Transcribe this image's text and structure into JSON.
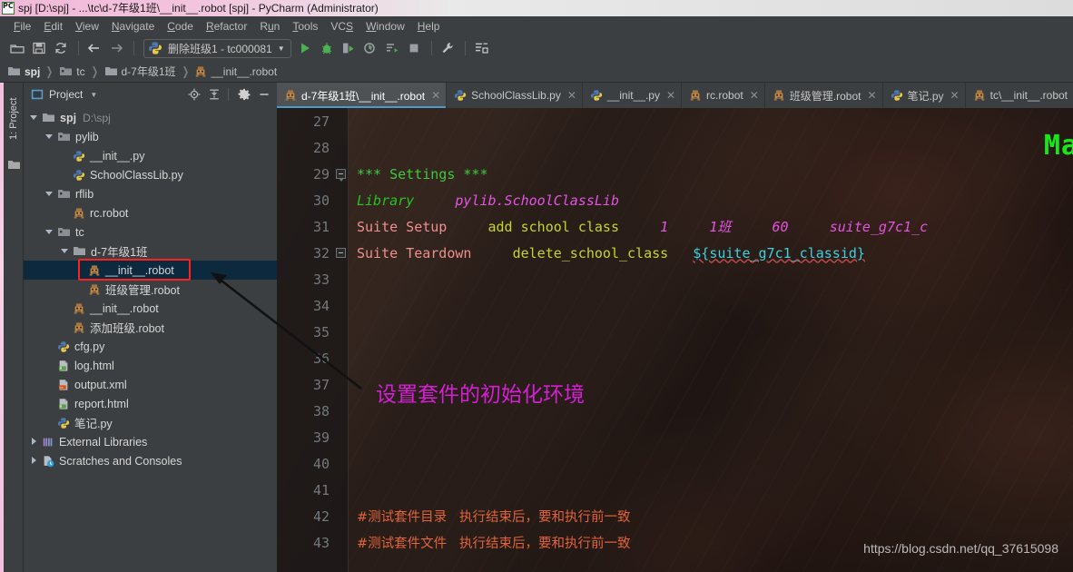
{
  "window": {
    "title": "spj [D:\\spj] - ...\\tc\\d-7年级1班\\__init__.robot [spj] - PyCharm (Administrator)",
    "app_icon": "pycharm-icon"
  },
  "menubar": {
    "items": [
      {
        "label": "File",
        "mnemonic": "F"
      },
      {
        "label": "Edit",
        "mnemonic": "E"
      },
      {
        "label": "View",
        "mnemonic": "V"
      },
      {
        "label": "Navigate",
        "mnemonic": "N"
      },
      {
        "label": "Code",
        "mnemonic": "C"
      },
      {
        "label": "Refactor",
        "mnemonic": "R"
      },
      {
        "label": "Run",
        "mnemonic": "u"
      },
      {
        "label": "Tools",
        "mnemonic": "T"
      },
      {
        "label": "VCS",
        "mnemonic": "S"
      },
      {
        "label": "Window",
        "mnemonic": "W"
      },
      {
        "label": "Help",
        "mnemonic": "H"
      }
    ]
  },
  "toolbar": {
    "buttons": [
      {
        "name": "open-icon"
      },
      {
        "name": "save-all-icon"
      },
      {
        "name": "sync-refresh-icon"
      },
      {
        "name": "back-arrow-icon"
      },
      {
        "name": "forward-arrow-icon"
      }
    ],
    "run_config": {
      "label": "删除班级1 - tc000081",
      "icon": "python-icon",
      "arrow": "▼"
    },
    "run_buttons": [
      {
        "name": "run-icon"
      },
      {
        "name": "debug-icon"
      },
      {
        "name": "run-with-coverage-icon"
      },
      {
        "name": "profile-icon"
      },
      {
        "name": "run-dashboard-icon"
      },
      {
        "name": "stop-icon"
      }
    ],
    "trailing": [
      {
        "name": "settings-wrench-icon"
      },
      {
        "name": "project-structure-icon"
      }
    ]
  },
  "breadcrumb": {
    "items": [
      {
        "label": "spj",
        "icon": "folder-icon",
        "bold": true
      },
      {
        "label": "tc",
        "icon": "module-icon",
        "bold": false
      },
      {
        "label": "d-7年级1班",
        "icon": "folder-icon",
        "bold": false
      },
      {
        "label": "__init__.robot",
        "icon": "robot-icon",
        "bold": false
      }
    ],
    "separator": "❯"
  },
  "toolstrip": {
    "label": "1: Project",
    "folder_icon": "folder-icon"
  },
  "project_panel": {
    "title": "Project",
    "dropdown_arrow": "▼",
    "header_buttons": [
      {
        "name": "locate-target-icon"
      },
      {
        "name": "collapse-all-icon"
      },
      {
        "name": "gear-icon"
      },
      {
        "name": "hide-minimize-icon"
      }
    ],
    "tree": [
      {
        "label": "spj",
        "sub": "D:\\spj",
        "icon": "folder-icon",
        "indent": 0,
        "twisty": "down",
        "bold": true,
        "selected": false
      },
      {
        "label": "pylib",
        "sub": "",
        "icon": "module-icon",
        "indent": 1,
        "twisty": "down",
        "bold": false,
        "selected": false
      },
      {
        "label": "__init__.py",
        "sub": "",
        "icon": "python-icon",
        "indent": 2,
        "twisty": "none",
        "bold": false,
        "selected": false
      },
      {
        "label": "SchoolClassLib.py",
        "sub": "",
        "icon": "python-icon",
        "indent": 2,
        "twisty": "none",
        "bold": false,
        "selected": false
      },
      {
        "label": "rflib",
        "sub": "",
        "icon": "module-icon",
        "indent": 1,
        "twisty": "down",
        "bold": false,
        "selected": false
      },
      {
        "label": "rc.robot",
        "sub": "",
        "icon": "robot-icon",
        "indent": 2,
        "twisty": "none",
        "bold": false,
        "selected": false
      },
      {
        "label": "tc",
        "sub": "",
        "icon": "module-icon",
        "indent": 1,
        "twisty": "down",
        "bold": false,
        "selected": false
      },
      {
        "label": "d-7年级1班",
        "sub": "",
        "icon": "folder-icon",
        "indent": 2,
        "twisty": "down",
        "bold": false,
        "selected": false
      },
      {
        "label": "__init__.robot",
        "sub": "",
        "icon": "robot-icon",
        "indent": 3,
        "twisty": "none",
        "bold": false,
        "selected": true
      },
      {
        "label": "班级管理.robot",
        "sub": "",
        "icon": "robot-icon",
        "indent": 3,
        "twisty": "none",
        "bold": false,
        "selected": false
      },
      {
        "label": "__init__.robot",
        "sub": "",
        "icon": "robot-icon",
        "indent": 2,
        "twisty": "none",
        "bold": false,
        "selected": false
      },
      {
        "label": "添加班级.robot",
        "sub": "",
        "icon": "robot-icon",
        "indent": 2,
        "twisty": "none",
        "bold": false,
        "selected": false
      },
      {
        "label": "cfg.py",
        "sub": "",
        "icon": "python-icon",
        "indent": 1,
        "twisty": "none",
        "bold": false,
        "selected": false
      },
      {
        "label": "log.html",
        "sub": "",
        "icon": "html-icon",
        "indent": 1,
        "twisty": "none",
        "bold": false,
        "selected": false
      },
      {
        "label": "output.xml",
        "sub": "",
        "icon": "xml-icon",
        "indent": 1,
        "twisty": "none",
        "bold": false,
        "selected": false
      },
      {
        "label": "report.html",
        "sub": "",
        "icon": "html-icon",
        "indent": 1,
        "twisty": "none",
        "bold": false,
        "selected": false
      },
      {
        "label": "笔记.py",
        "sub": "",
        "icon": "python-icon",
        "indent": 1,
        "twisty": "none",
        "bold": false,
        "selected": false
      },
      {
        "label": "External Libraries",
        "sub": "",
        "icon": "libraries-icon",
        "indent": 0,
        "twisty": "right",
        "bold": false,
        "selected": false
      },
      {
        "label": "Scratches and Consoles",
        "sub": "",
        "icon": "scratches-icon",
        "indent": 0,
        "twisty": "right",
        "bold": false,
        "selected": false
      }
    ]
  },
  "editor": {
    "tabs": [
      {
        "label": "d-7年级1班\\__init__.robot",
        "icon": "robot-icon",
        "active": true,
        "close": "✕"
      },
      {
        "label": "SchoolClassLib.py",
        "icon": "python-icon",
        "active": false,
        "close": "✕"
      },
      {
        "label": "__init__.py",
        "icon": "python-icon",
        "active": false,
        "close": "✕"
      },
      {
        "label": "rc.robot",
        "icon": "robot-icon",
        "active": false,
        "close": "✕"
      },
      {
        "label": "班级管理.robot",
        "icon": "robot-icon",
        "active": false,
        "close": "✕"
      },
      {
        "label": "笔记.py",
        "icon": "python-icon",
        "active": false,
        "close": "✕"
      },
      {
        "label": "tc\\__init__.robot",
        "icon": "robot-icon",
        "active": false,
        "close": "✕"
      }
    ],
    "lines": [
      {
        "num": "27",
        "fold": "none",
        "segments": []
      },
      {
        "num": "28",
        "fold": "none",
        "segments": []
      },
      {
        "num": "29",
        "fold": "open",
        "segments": [
          {
            "text": "*** Settings ***",
            "cls": "tok-section"
          }
        ]
      },
      {
        "num": "30",
        "fold": "none",
        "segments": [
          {
            "text": "Library",
            "cls": "tok-setting"
          },
          {
            "text": "     ",
            "cls": "tok-plain"
          },
          {
            "text": "pylib.SchoolClassLib",
            "cls": "tok-lib"
          }
        ]
      },
      {
        "num": "31",
        "fold": "none",
        "segments": [
          {
            "text": "Suite Setup",
            "cls": "tok-kw"
          },
          {
            "text": "     ",
            "cls": "tok-plain"
          },
          {
            "text": "add school class",
            "cls": "tok-kword"
          },
          {
            "text": "     ",
            "cls": "tok-plain"
          },
          {
            "text": "1",
            "cls": "tok-arg"
          },
          {
            "text": "     ",
            "cls": "tok-plain"
          },
          {
            "text": "1班",
            "cls": "tok-arg"
          },
          {
            "text": "     ",
            "cls": "tok-plain"
          },
          {
            "text": "60",
            "cls": "tok-arg"
          },
          {
            "text": "     ",
            "cls": "tok-plain"
          },
          {
            "text": "suite_g7c1_c",
            "cls": "tok-arg"
          }
        ]
      },
      {
        "num": "32",
        "fold": "close",
        "segments": [
          {
            "text": "Suite Teardown",
            "cls": "tok-kw"
          },
          {
            "text": "     ",
            "cls": "tok-plain"
          },
          {
            "text": "delete_school_class",
            "cls": "tok-kword"
          },
          {
            "text": "   ",
            "cls": "tok-plain"
          },
          {
            "text": "${suite_g7c1_classid}",
            "cls": "tok-var"
          }
        ]
      },
      {
        "num": "33",
        "fold": "none",
        "segments": []
      },
      {
        "num": "34",
        "fold": "none",
        "segments": []
      },
      {
        "num": "35",
        "fold": "none",
        "segments": []
      },
      {
        "num": "36",
        "fold": "none",
        "segments": []
      },
      {
        "num": "37",
        "fold": "none",
        "segments": []
      },
      {
        "num": "38",
        "fold": "none",
        "segments": []
      },
      {
        "num": "39",
        "fold": "none",
        "segments": []
      },
      {
        "num": "40",
        "fold": "none",
        "segments": []
      },
      {
        "num": "41",
        "fold": "none",
        "segments": []
      },
      {
        "num": "42",
        "fold": "none",
        "segments": [
          {
            "text": "#测试套件目录   执行结束后，要和执行前一致",
            "cls": "tok-comment"
          }
        ]
      },
      {
        "num": "43",
        "fold": "none",
        "segments": [
          {
            "text": "#测试套件文件   执行结束后，要和执行前一致",
            "cls": "tok-comment"
          }
        ]
      }
    ]
  },
  "annotations": {
    "callout_text": "设置套件的初始化环境",
    "callout_color": "#d41fd4",
    "highlight_box_color": "#ff2020",
    "arrow_color": "#111111",
    "background_green_text": "Ma",
    "background_green_color": "#18e818",
    "watermark": "https://blog.csdn.net/qq_37615098"
  }
}
